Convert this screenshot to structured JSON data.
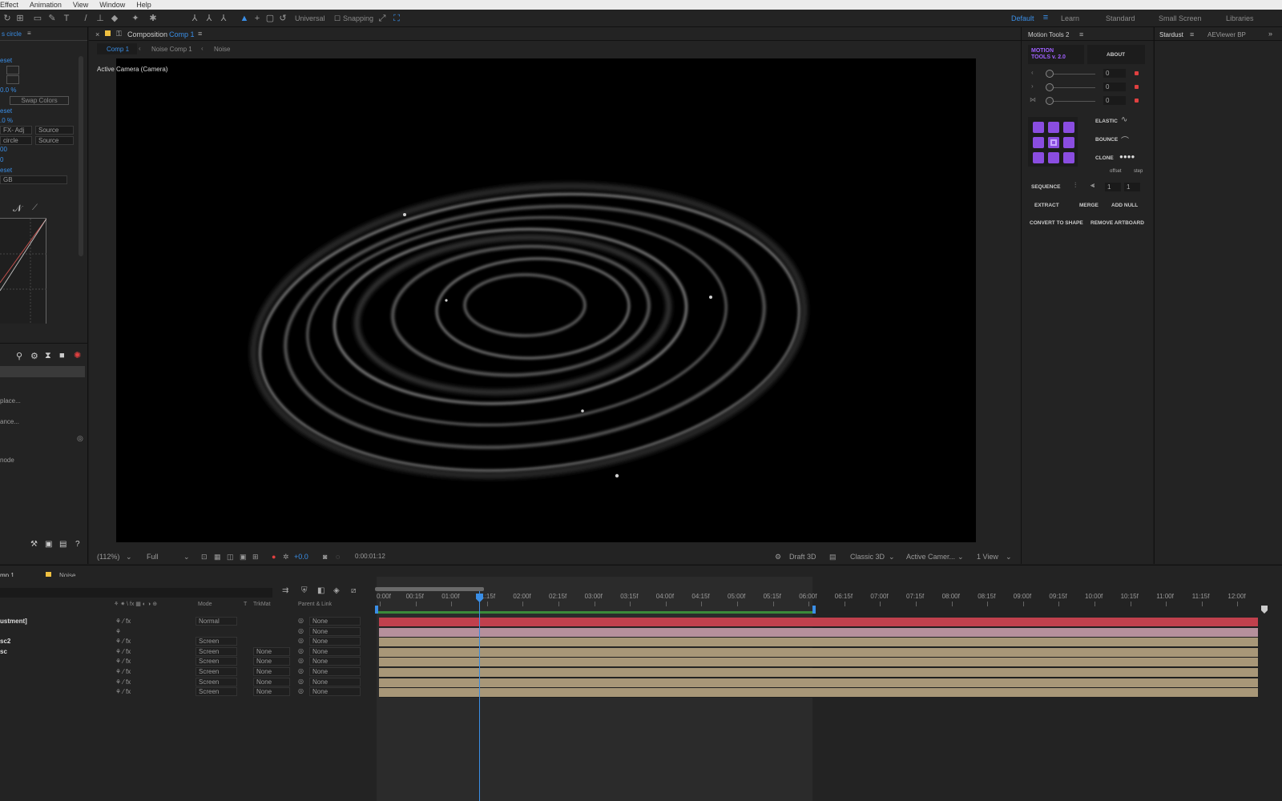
{
  "menubar": {
    "items": [
      "Effect",
      "Animation",
      "View",
      "Window",
      "Help"
    ]
  },
  "toolbar": {
    "universal_label": "Universal",
    "snapping_label": "Snapping",
    "workspaces": [
      "Default",
      "Learn",
      "Standard",
      "Small Screen",
      "Libraries"
    ],
    "active_workspace": "Default"
  },
  "left_panel": {
    "title": "s circle",
    "rows": [
      {
        "text": "eset",
        "blue": true
      },
      {
        "text": "0.0 %",
        "blue": true
      },
      {
        "text": "eset",
        "blue": true
      },
      {
        "text": ".0 %",
        "blue": true
      },
      {
        "text": "00",
        "blue": true
      },
      {
        "text": "0",
        "blue": true
      },
      {
        "text": "eset",
        "blue": true
      }
    ],
    "swap_colors": "Swap Colors",
    "sel_fx_adj": "FX- Adj",
    "sel_source1": "Source",
    "sel_circle": "circle",
    "sel_source2": "Source",
    "sel_rgb": "GB",
    "list_items": [
      "place...",
      "ance...",
      "node"
    ]
  },
  "comp_panel": {
    "tab_prefix": "Composition",
    "tab_name": "Comp 1",
    "breadcrumbs": [
      "Comp 1",
      "Noise Comp 1",
      "Noise"
    ],
    "viewer_label": "Active Camera (Camera)",
    "zoom": "(112%)",
    "resolution": "Full",
    "exposure": "+0.0",
    "timecode": "0:00:01:12",
    "draft3d": "Draft 3D",
    "renderer": "Classic 3D",
    "camera": "Active Camer...",
    "views": "1 View"
  },
  "motion_tools": {
    "title": "Motion Tools 2",
    "logo_line1": "MOTION",
    "logo_line2": "TOOLS v. 2.0",
    "about": "ABOUT",
    "slider_values": [
      "0",
      "0",
      "0"
    ],
    "elastic": "ELASTIC",
    "bounce": "BOUNCE",
    "clone": "CLONE",
    "offset": "offset",
    "step": "step",
    "sequence": "SEQUENCE",
    "seq_values": [
      "1",
      "1"
    ],
    "extract": "EXTRACT",
    "merge": "MERGE",
    "add_null": "ADD NULL",
    "convert_to_shape": "CONVERT TO SHAPE",
    "remove_artboard": "REMOVE ARTBOARD"
  },
  "stardust_panel": {
    "tabs": [
      "Stardust",
      "AEViewer BP"
    ]
  },
  "timeline": {
    "tabs": [
      "mp 1",
      "Noise"
    ],
    "columns": [
      "Mode",
      "T",
      "TrkMat",
      "Parent & Link"
    ],
    "ruler": [
      "0:00f",
      "00:15f",
      "01:00f",
      "01:15f",
      "02:00f",
      "02:15f",
      "03:00f",
      "03:15f",
      "04:00f",
      "04:15f",
      "05:00f",
      "05:15f",
      "06:00f",
      "06:15f",
      "07:00f",
      "07:15f",
      "08:00f",
      "08:15f",
      "09:00f",
      "09:15f",
      "10:00f",
      "10:15f",
      "11:00f",
      "11:15f",
      "12:00f"
    ],
    "layers": [
      {
        "name": "ustment]",
        "mode": "Normal",
        "trkmat": "",
        "parent": "None",
        "color": "#c0404d"
      },
      {
        "name": "",
        "mode": "",
        "trkmat": "",
        "parent": "None",
        "color": "#b6909c"
      },
      {
        "name": "sc2",
        "mode": "Screen",
        "trkmat": "",
        "parent": "None",
        "color": "#a89778"
      },
      {
        "name": "sc",
        "mode": "Screen",
        "trkmat": "None",
        "parent": "None",
        "color": "#a89778"
      },
      {
        "name": "",
        "mode": "Screen",
        "trkmat": "None",
        "parent": "None",
        "color": "#a89778"
      },
      {
        "name": "",
        "mode": "Screen",
        "trkmat": "None",
        "parent": "None",
        "color": "#a89778"
      },
      {
        "name": "",
        "mode": "Screen",
        "trkmat": "None",
        "parent": "None",
        "color": "#a89778"
      },
      {
        "name": "",
        "mode": "Screen",
        "trkmat": "None",
        "parent": "None",
        "color": "#a89778"
      }
    ]
  },
  "colors": {
    "accent": "#3a8ee6",
    "motion_tools_purple": "#8a4de0",
    "adjustment_layer": "#c0404d",
    "footage_layer": "#a89778"
  }
}
